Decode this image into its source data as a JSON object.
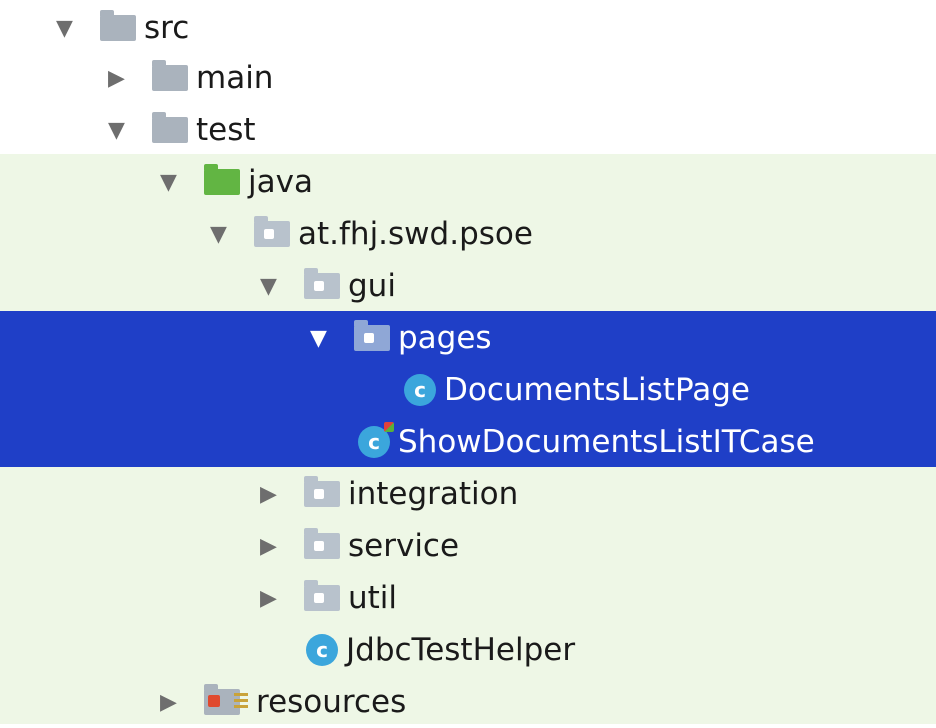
{
  "tree": {
    "nodes": [
      {
        "label": "src",
        "icon": "folder-icon",
        "expanded": true
      },
      {
        "label": "main",
        "icon": "folder-icon",
        "expanded": false
      },
      {
        "label": "test",
        "icon": "folder-icon",
        "expanded": true
      },
      {
        "label": "java",
        "icon": "test-source-folder-icon",
        "expanded": true
      },
      {
        "label": "at.fhj.swd.psoe",
        "icon": "package-icon",
        "expanded": true
      },
      {
        "label": "gui",
        "icon": "package-icon",
        "expanded": true
      },
      {
        "label": "pages",
        "icon": "package-icon",
        "expanded": true,
        "selected": true
      },
      {
        "label": "DocumentsListPage",
        "icon": "java-class-icon",
        "badge": "c",
        "selected": true
      },
      {
        "label": "ShowDocumentsListITCase",
        "icon": "java-test-class-icon",
        "badge": "c",
        "selected": true
      },
      {
        "label": "integration",
        "icon": "package-icon",
        "expanded": false
      },
      {
        "label": "service",
        "icon": "package-icon",
        "expanded": false
      },
      {
        "label": "util",
        "icon": "package-icon",
        "expanded": false
      },
      {
        "label": "JdbcTestHelper",
        "icon": "java-class-icon",
        "badge": "c"
      },
      {
        "label": "resources",
        "icon": "resources-folder-icon",
        "expanded": false
      }
    ],
    "toggle_glyphs": {
      "expanded": "▼",
      "collapsed": "▶"
    }
  },
  "colors": {
    "selection": "#1f3fc7",
    "test_scope_bg": "#eef7e6",
    "class_icon": "#3ba6dc",
    "test_folder": "#62b543"
  }
}
